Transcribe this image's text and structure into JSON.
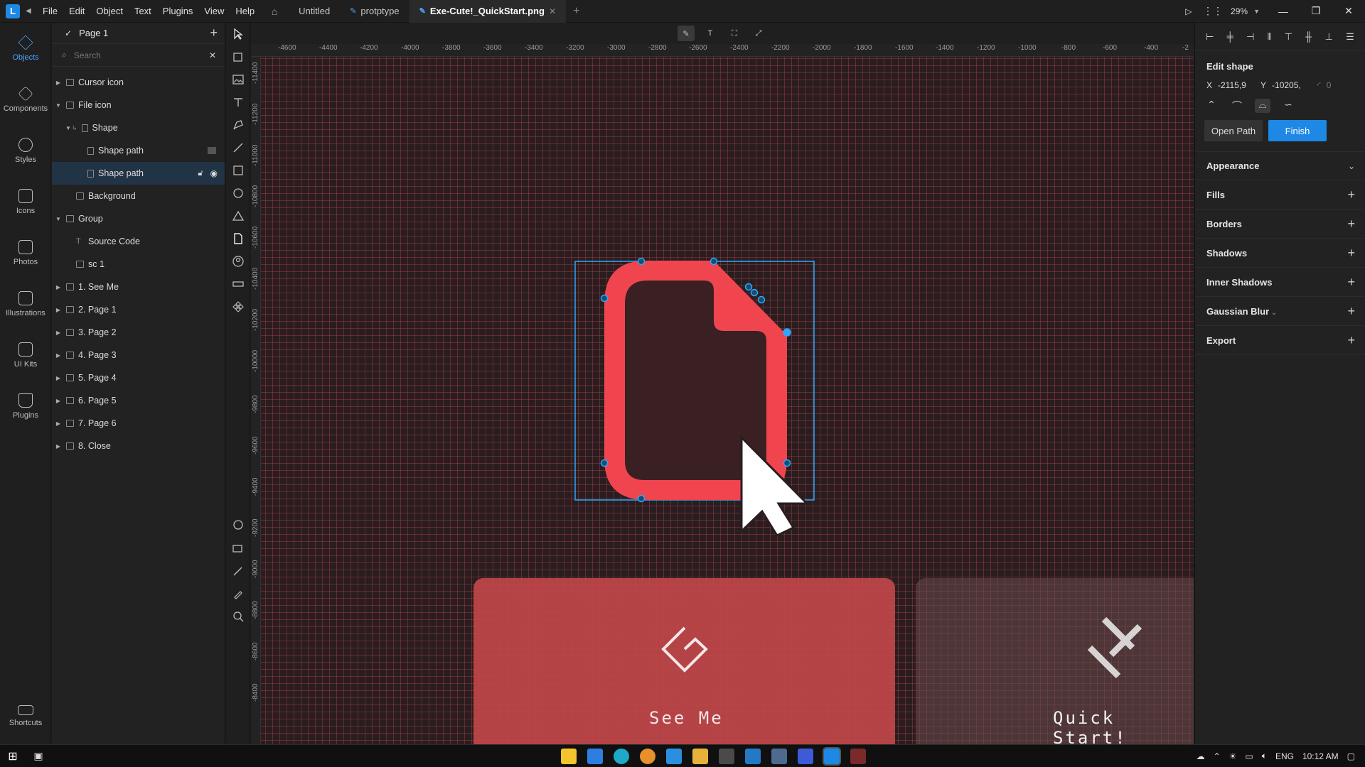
{
  "app": {
    "menu": [
      "File",
      "Edit",
      "Object",
      "Text",
      "Plugins",
      "View",
      "Help"
    ],
    "tabs": [
      {
        "label": "Untitled",
        "active": false
      },
      {
        "label": "protptype",
        "active": false
      },
      {
        "label": "Exe-Cute!_QuickStart.png",
        "active": true
      }
    ],
    "zoom": "29%"
  },
  "rail": {
    "items": [
      "Objects",
      "Components",
      "Styles",
      "Icons",
      "Photos",
      "Illustrations",
      "UI Kits",
      "Plugins"
    ],
    "bottom": "Shortcuts"
  },
  "layers": {
    "page": "Page 1",
    "search_placeholder": "Search",
    "items": [
      {
        "label": "Cursor icon"
      },
      {
        "label": "File icon"
      },
      {
        "label": "Shape"
      },
      {
        "label": "Shape path"
      },
      {
        "label": "Shape path"
      },
      {
        "label": "Background"
      },
      {
        "label": "Group"
      },
      {
        "label": "Source Code"
      },
      {
        "label": "sc 1"
      },
      {
        "label": "1. See Me"
      },
      {
        "label": "2. Page 1"
      },
      {
        "label": "3. Page 2"
      },
      {
        "label": "4. Page 3"
      },
      {
        "label": "5. Page 4"
      },
      {
        "label": "6. Page 5"
      },
      {
        "label": "7. Page 6"
      },
      {
        "label": "8. Close"
      }
    ]
  },
  "rulers": {
    "top": [
      "-4600",
      "-4400",
      "-4200",
      "-4000",
      "-3800",
      "-3600",
      "-3400",
      "-3200",
      "-3000",
      "-2800",
      "-2600",
      "-2400",
      "-2200",
      "-2000",
      "-1800",
      "-1600",
      "-1400",
      "-1200",
      "-1000",
      "-800",
      "-600",
      "-400",
      "-2"
    ],
    "left": [
      "-11400",
      "-11200",
      "-11000",
      "-10800",
      "-10600",
      "-10400",
      "-10200",
      "-10000",
      "-9800",
      "-9600",
      "-9400",
      "-9200",
      "-9000",
      "-8800",
      "-8600",
      "-8400"
    ]
  },
  "canvas": {
    "card1_label": "See Me",
    "card2_label": "Quick Start!"
  },
  "inspector": {
    "title": "Edit shape",
    "x_label": "X",
    "x_value": "-2115,9",
    "y_label": "Y",
    "y_value": "-10205,",
    "radius_value": "0",
    "open_path": "Open Path",
    "finish": "Finish",
    "sections": [
      "Appearance",
      "Fills",
      "Borders",
      "Shadows",
      "Inner Shadows",
      "Gaussian Blur",
      "Export"
    ]
  },
  "taskbar": {
    "lang": "ENG",
    "time": "10:12 AM"
  },
  "colors": {
    "accent": "#1e88e5",
    "shape_red": "#f0454f",
    "card_red": "#c0474a"
  }
}
